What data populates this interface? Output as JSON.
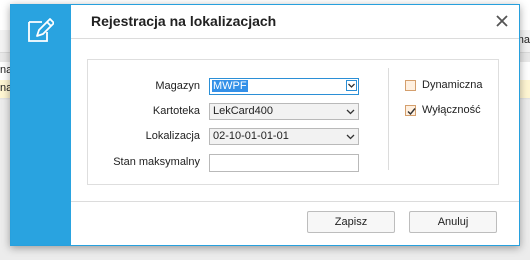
{
  "background": {
    "row1_left": "na",
    "row2_left": "na",
    "header_right": "ma"
  },
  "dialog": {
    "title": "Rejestracja na lokalizacjach",
    "icon": "edit-document-icon",
    "close_icon": "close-icon",
    "accent_color": "#29a3e0"
  },
  "form": {
    "magazyn": {
      "label": "Magazyn",
      "value": "MWPF"
    },
    "kartoteka": {
      "label": "Kartoteka",
      "value": "LekCard400"
    },
    "lokalizacja": {
      "label": "Lokalizacja",
      "value": "02-10-01-01-01"
    },
    "stan_maksymalny": {
      "label": "Stan maksymalny",
      "value": ""
    }
  },
  "options": {
    "dynamiczna": {
      "label": "Dynamiczna",
      "checked": false
    },
    "wylacznosc": {
      "label": "Wyłączność",
      "checked": true
    }
  },
  "buttons": {
    "save": "Zapisz",
    "cancel": "Anuluj"
  }
}
